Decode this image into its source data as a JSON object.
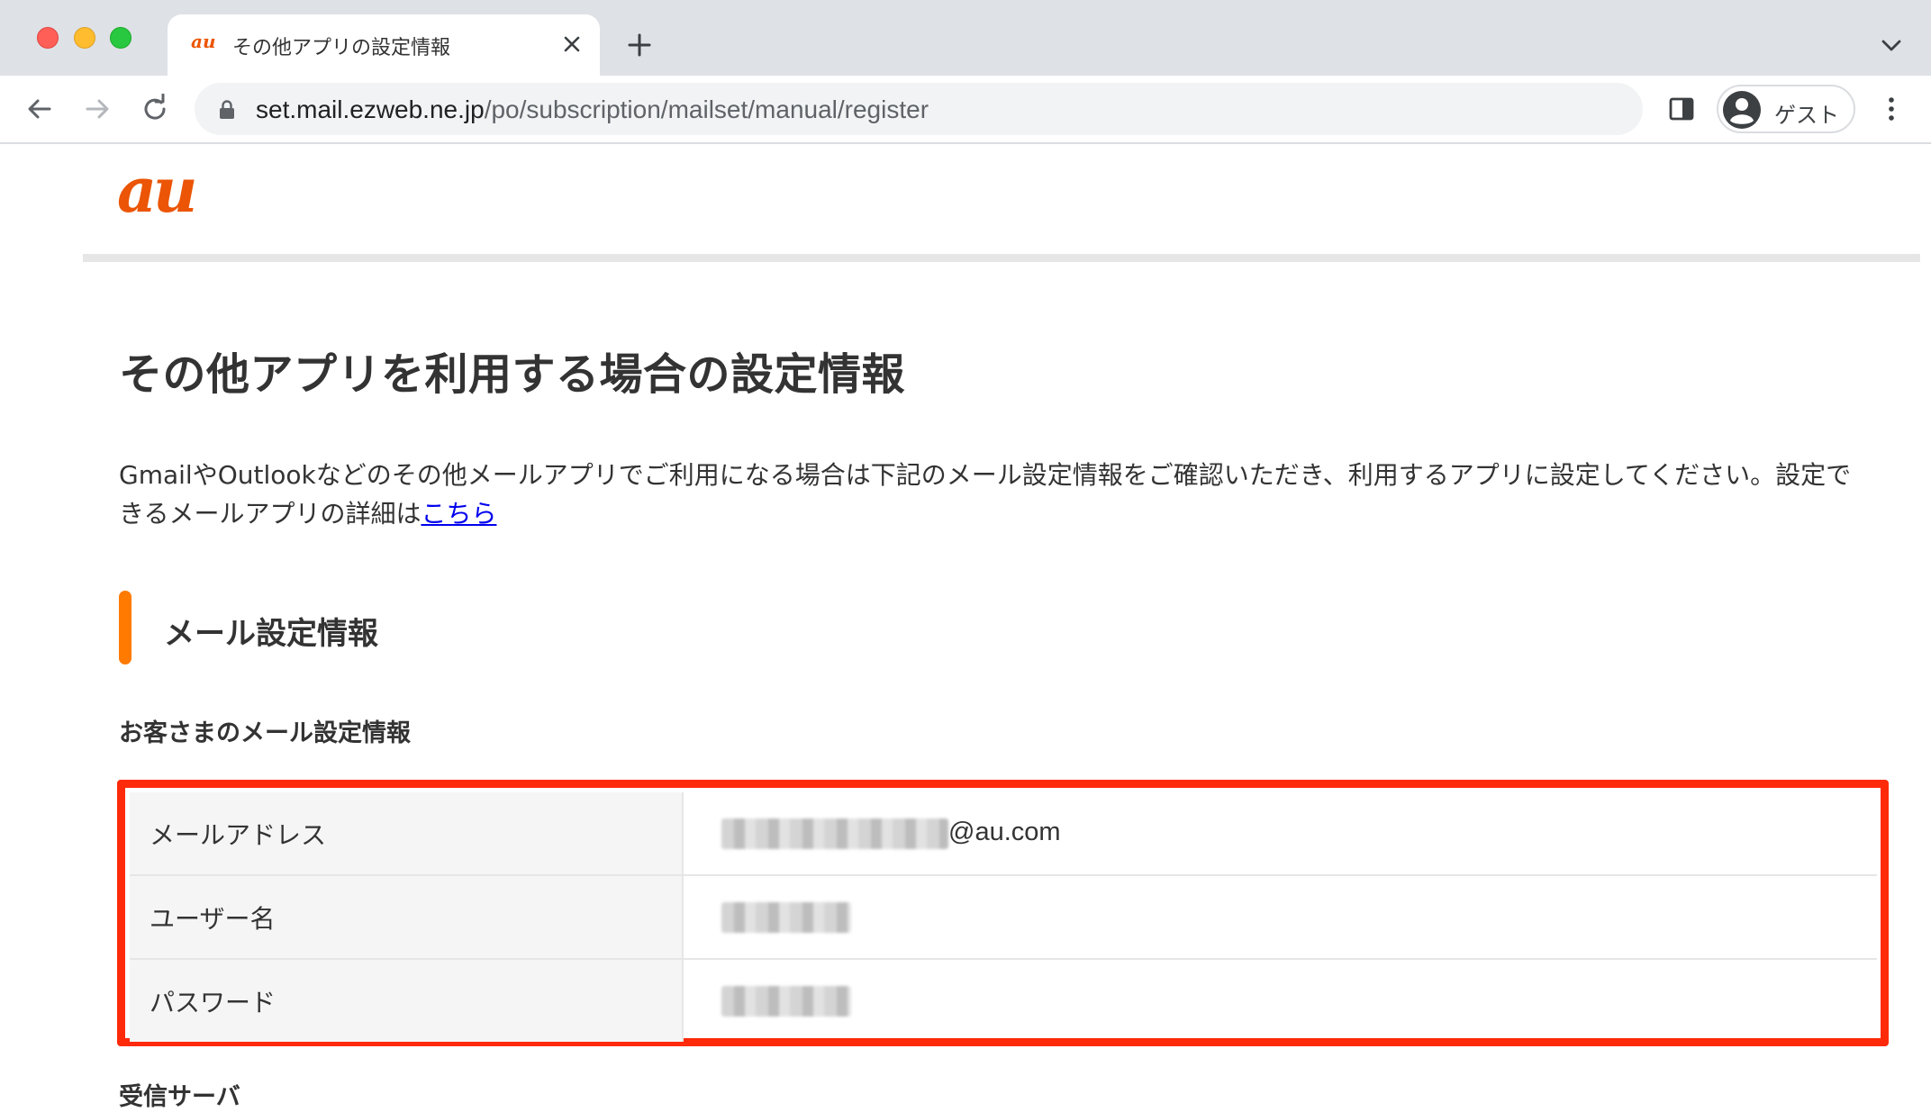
{
  "browser": {
    "tab": {
      "favicon_text": "au",
      "title": "その他アプリの設定情報"
    },
    "url": {
      "host": "set.mail.ezweb.ne.jp",
      "path": "/po/subscription/mailset/manual/register"
    },
    "profile_label": "ゲスト"
  },
  "page": {
    "logo_text": "au",
    "title": "その他アプリを利用する場合の設定情報",
    "intro_text": "GmailやOutlookなどのその他メールアプリでご利用になる場合は下記のメール設定情報をご確認いただき、利用するアプリに設定してください。設定できるメールアプリの詳細は",
    "intro_link": "こちら",
    "section_title": "メール設定情報",
    "subsection_title": "お客さまのメール設定情報",
    "settings": [
      {
        "label": "メールアドレス",
        "value_suffix": "@au.com"
      },
      {
        "label": "ユーザー名",
        "value_suffix": ""
      },
      {
        "label": "パスワード",
        "value_suffix": ""
      }
    ],
    "next_heading": "受信サーバ"
  },
  "colors": {
    "brand_orange": "#eb5505",
    "section_accent": "#ff7a00",
    "highlight_border": "#ff2a0a",
    "link": "#0000ee"
  }
}
